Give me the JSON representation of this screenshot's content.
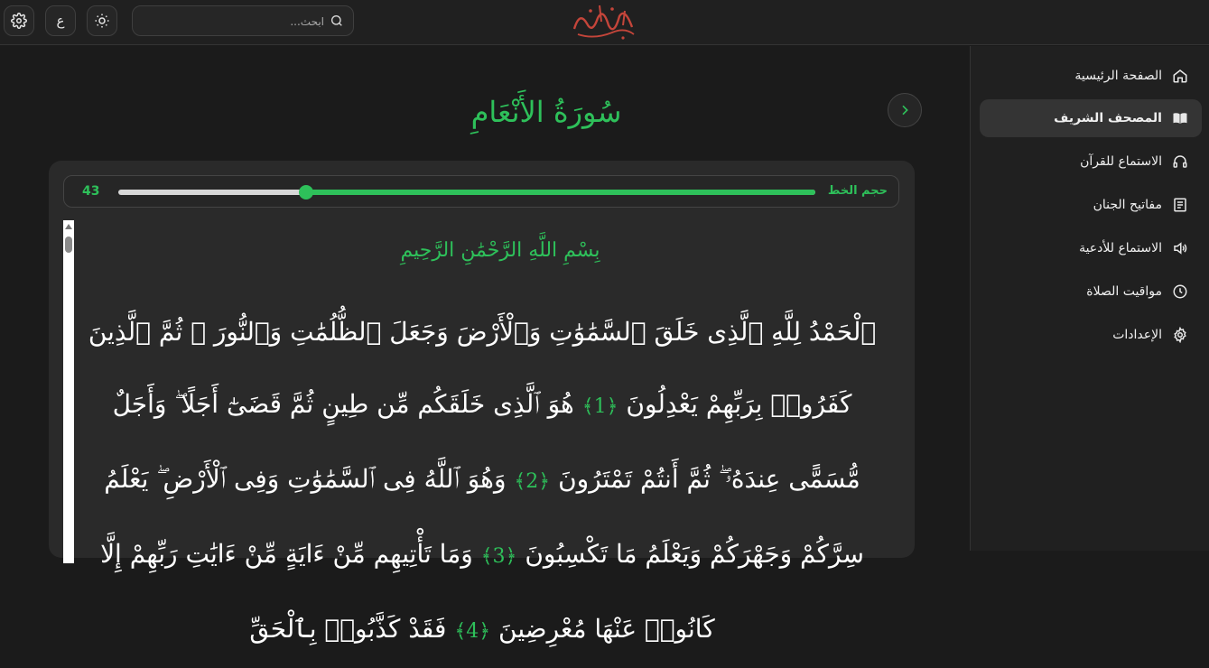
{
  "topbar": {
    "search_placeholder": "ابحث...",
    "language_button": "ع",
    "logo_text": "نور على نور"
  },
  "sidebar": {
    "items": [
      {
        "label": "الصفحة الرئيسية",
        "icon": "home-icon",
        "active": false
      },
      {
        "label": "المصحف الشريف",
        "icon": "book-icon",
        "active": true
      },
      {
        "label": "الاستماع للقرآن",
        "icon": "headphones-icon",
        "active": false
      },
      {
        "label": "مفاتيح الجنان",
        "icon": "document-icon",
        "active": false
      },
      {
        "label": "الاستماع للأدعية",
        "icon": "speaker-icon",
        "active": false
      },
      {
        "label": "مواقيت الصلاة",
        "icon": "clock-icon",
        "active": false
      },
      {
        "label": "الإعدادات",
        "icon": "gear-icon",
        "active": false
      }
    ]
  },
  "main": {
    "surah_title": "سُورَةُ الأَنْعَامِ",
    "font_size_label": "حجم الخط",
    "font_size_value": "43",
    "font_size_fraction": 0.27,
    "basmala": "بِسْمِ اللَّهِ الرَّحْمَٰنِ الرَّحِيمِ",
    "verses": [
      {
        "text": "ٱلْحَمْدُ لِلَّهِ ٱلَّذِى خَلَقَ ٱلسَّمَٰوَٰتِ وَٱلْأَرْضَ وَجَعَلَ ٱلظُّلُمَٰتِ وَٱلنُّورَ ۖ ثُمَّ ٱلَّذِينَ كَفَرُوا۟ بِرَبِّهِمْ يَعْدِلُونَ",
        "marker": "﴿1﴾"
      },
      {
        "text": "هُوَ ٱلَّذِى خَلَقَكُم مِّن طِينٍ ثُمَّ قَضَىٰٓ أَجَلًا ۖ وَأَجَلٌ مُّسَمًّى عِندَهُۥ ۖ ثُمَّ أَنتُمْ تَمْتَرُونَ",
        "marker": "﴿2﴾"
      },
      {
        "text": "وَهُوَ ٱللَّهُ فِى ٱلسَّمَٰوَٰتِ وَفِى ٱلْأَرْضِ ۖ يَعْلَمُ سِرَّكُمْ وَجَهْرَكُمْ وَيَعْلَمُ مَا تَكْسِبُونَ",
        "marker": "﴿3﴾"
      },
      {
        "text": "وَمَا تَأْتِيهِم مِّنْ ءَايَةٍ مِّنْ ءَايَٰتِ رَبِّهِمْ إِلَّا كَانُوا۟ عَنْهَا مُعْرِضِينَ",
        "marker": "﴿4﴾"
      },
      {
        "text": "فَقَدْ كَذَّبُوا۟ بِٱلْحَقِّ",
        "marker": ""
      }
    ]
  },
  "colors": {
    "accent": "#2ec05a",
    "background": "#1b1b1b",
    "panel": "#2a2a2a",
    "sidebar": "#202020"
  }
}
